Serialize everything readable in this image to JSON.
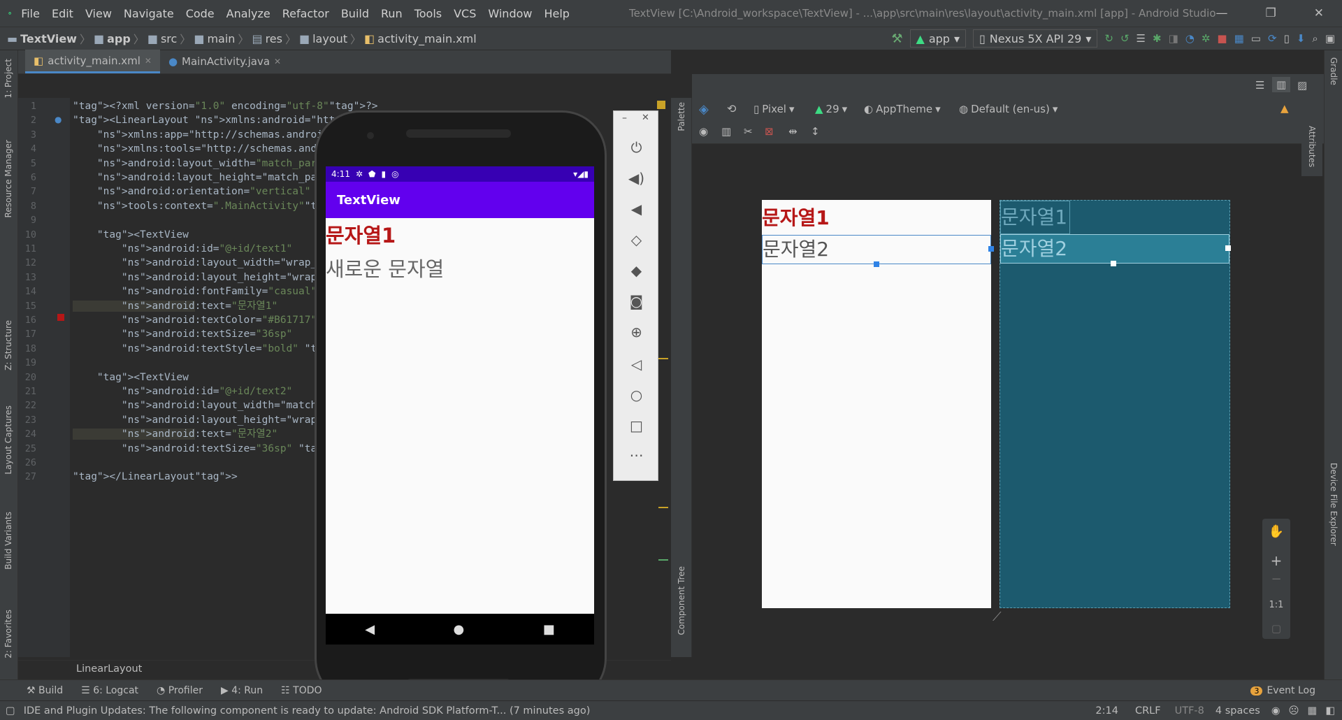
{
  "menubar": {
    "items": [
      "File",
      "Edit",
      "View",
      "Navigate",
      "Code",
      "Analyze",
      "Refactor",
      "Build",
      "Run",
      "Tools",
      "VCS",
      "Window",
      "Help"
    ],
    "title": "TextView [C:\\Android_workspace\\TextView] - ...\\app\\src\\main\\res\\layout\\activity_main.xml [app] - Android Studio"
  },
  "breadcrumbs": [
    "TextView",
    "app",
    "src",
    "main",
    "res",
    "layout",
    "activity_main.xml"
  ],
  "toolbar": {
    "run_config": "app",
    "device": "Nexus 5X API 29"
  },
  "tabs": [
    {
      "label": "activity_main.xml",
      "active": true
    },
    {
      "label": "MainActivity.java",
      "active": false
    }
  ],
  "code_lines": [
    {
      "n": "1",
      "text": "<?xml version=\"1.0\" encoding=\"utf-8\"?>"
    },
    {
      "n": "2",
      "text": "<LinearLayout xmlns:android=\"http://sche"
    },
    {
      "n": "3",
      "text": "    xmlns:app=\"http://schemas.android.c"
    },
    {
      "n": "4",
      "text": "    xmlns:tools=\"http://schemas.androic"
    },
    {
      "n": "5",
      "text": "    android:layout_width=\"match_parent\""
    },
    {
      "n": "6",
      "text": "    android:layout_height=\"match_parent"
    },
    {
      "n": "7",
      "text": "    android:orientation=\"vertical\""
    },
    {
      "n": "8",
      "text": "    tools:context=\".MainActivity\">"
    },
    {
      "n": "9",
      "text": ""
    },
    {
      "n": "10",
      "text": "    <TextView"
    },
    {
      "n": "11",
      "text": "        android:id=\"@+id/text1\""
    },
    {
      "n": "12",
      "text": "        android:layout_width=\"wrap_cont"
    },
    {
      "n": "13",
      "text": "        android:layout_height=\"wrap_cor"
    },
    {
      "n": "14",
      "text": "        android:fontFamily=\"casual\""
    },
    {
      "n": "15",
      "text": "        android:text=\"문자열1\""
    },
    {
      "n": "16",
      "text": "        android:textColor=\"#B61717\""
    },
    {
      "n": "17",
      "text": "        android:textSize=\"36sp\""
    },
    {
      "n": "18",
      "text": "        android:textStyle=\"bold\" />"
    },
    {
      "n": "19",
      "text": ""
    },
    {
      "n": "20",
      "text": "    <TextView"
    },
    {
      "n": "21",
      "text": "        android:id=\"@+id/text2\""
    },
    {
      "n": "22",
      "text": "        android:layout_width=\"match_par"
    },
    {
      "n": "23",
      "text": "        android:layout_height=\"wrap_cor"
    },
    {
      "n": "24",
      "text": "        android:text=\"문자열2\""
    },
    {
      "n": "25",
      "text": "        android:textSize=\"36sp\" />"
    },
    {
      "n": "26",
      "text": ""
    },
    {
      "n": "27",
      "text": "</LinearLayout>"
    }
  ],
  "editor_footer": "LinearLayout",
  "design_toolbar": {
    "device": "Pixel",
    "api": "29",
    "theme": "AppTheme",
    "locale": "Default (en-us)"
  },
  "preview": {
    "text1": "문자열1",
    "text2": "문자열2",
    "text1_color": "#B61717"
  },
  "blueprint": {
    "text1": "문자열1",
    "text2": "문자열2"
  },
  "emulator": {
    "time": "4:11",
    "app_title": "TextView",
    "text1": "문자열1",
    "text2": "새로운 문자열",
    "appbar_color": "#6200EE",
    "statusbar_color": "#3700B3"
  },
  "zoom": {
    "plus": "+",
    "minus": "−",
    "fit": "1:1"
  },
  "bottom_tools": [
    {
      "label": "Build",
      "icon": "hammer-icon"
    },
    {
      "label": "6: Logcat",
      "icon": "logcat-icon"
    },
    {
      "label": "Profiler",
      "icon": "profiler-icon"
    },
    {
      "label": "4: Run",
      "icon": "run-icon"
    },
    {
      "label": "TODO",
      "icon": "todo-icon"
    }
  ],
  "event_log": {
    "label": "Event Log",
    "count": "3"
  },
  "status": {
    "message": "IDE and Plugin Updates: The following component is ready to update: Android SDK Platform-T... (7 minutes ago)",
    "position": "2:14",
    "line_sep": "CRLF",
    "encoding": "UTF-8",
    "indent": "4 spaces"
  },
  "left_tools": [
    "1: Project",
    "Resource Manager",
    "Z: Structure",
    "Layout Captures",
    "Build Variants",
    "2: Favorites"
  ],
  "right_tools": [
    "Gradle",
    "Attributes",
    "Device File Explorer"
  ],
  "side_panels": {
    "palette": "Palette",
    "component_tree": "Component Tree"
  }
}
